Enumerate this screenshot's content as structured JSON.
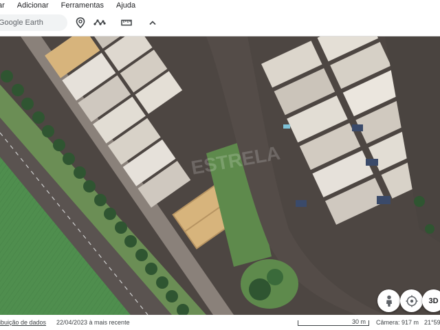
{
  "menu": {
    "items": [
      "ar",
      "Adicionar",
      "Ferramentas",
      "Ajuda"
    ]
  },
  "toolbar": {
    "search_placeholder": "Google Earth",
    "icons": [
      "placemark-icon",
      "path-icon",
      "ruler-icon",
      "collapse-chevron-icon"
    ]
  },
  "map": {
    "watermark": "ESTRELA",
    "colors": {
      "accent_house": "#d7b47c",
      "lawn": "#5e8a4c",
      "road": "#4d4642",
      "field": "#4f8e4e"
    }
  },
  "controls": {
    "pegman_icon": "pegman-icon",
    "compass_icon": "compass-icon",
    "view_3d_label": "3D"
  },
  "statusbar": {
    "attribution": "ribuição de dados",
    "imagery_date": "22/04/2023 à mais recente",
    "scale_label": "30 m",
    "camera": "Câmera: 917 m",
    "coords": "21°59"
  }
}
